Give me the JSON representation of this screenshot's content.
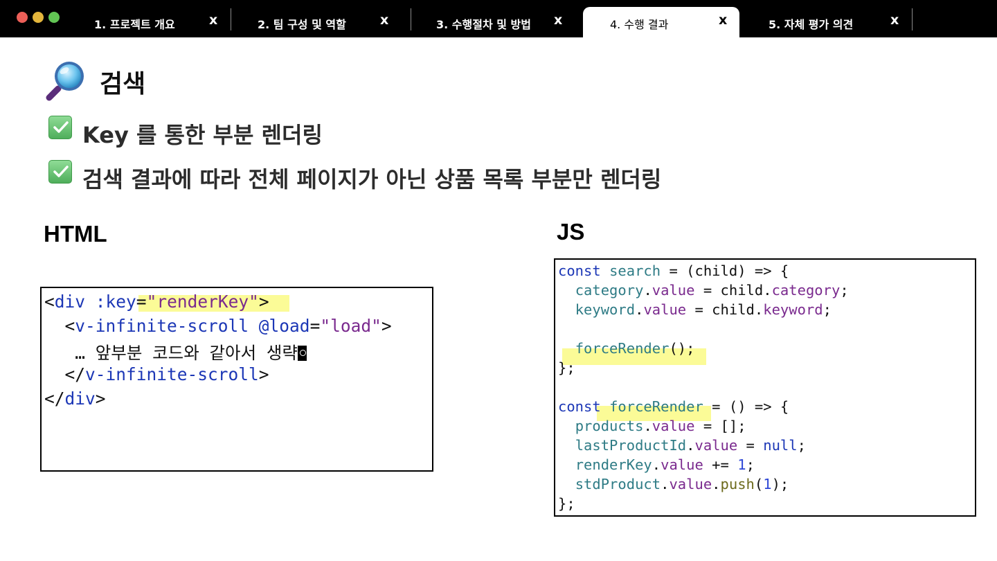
{
  "tabs": [
    {
      "label": "1. 프로젝트 개요",
      "close": "x",
      "active": false
    },
    {
      "label": "2. 팀 구성 및 역할",
      "close": "x",
      "active": false
    },
    {
      "label": "3. 수행절차 및 방법",
      "close": "x",
      "active": false
    },
    {
      "label": "4. 수행 결과",
      "close": "x",
      "active": true
    },
    {
      "label": "5. 자체 평가 의견",
      "close": "x",
      "active": false
    }
  ],
  "heading": {
    "title": "검색"
  },
  "bullets": [
    "Key 를 통한 부분 렌더링",
    "검색 결과에 따라 전체 페이지가 아닌 상품 목록 부분만 렌더링"
  ],
  "sections": {
    "html_label": "HTML",
    "js_label": "JS"
  },
  "html_code": {
    "l1": {
      "open": "<",
      "tag": "div",
      "attr": " :key",
      "eq": "=",
      "q1": "\"",
      "val": "renderKey",
      "q2": "\"",
      "close": ">"
    },
    "l2": {
      "indent": "  ",
      "open": "<",
      "tag": "v-infinite-scroll",
      "attr": " @load",
      "eq": "=",
      "q1": "\"",
      "val": "load",
      "q2": "\"",
      "close": ">"
    },
    "l3": {
      "text": "   … 앞부분 코드와 같아서 생략"
    },
    "l4": {
      "indent": "  ",
      "open": "</",
      "tag": "v-infinite-scroll",
      "close": ">"
    },
    "l5": {
      "open": "</",
      "tag": "div",
      "close": ">"
    }
  },
  "js_code": {
    "l1": {
      "kw": "const",
      "sp": " ",
      "name": "search",
      "rest": " = (child) => {"
    },
    "l2": {
      "indent": "  ",
      "obj": "category",
      "dot": ".",
      "prop": "value",
      "mid": " = child.",
      "prop2": "category",
      "end": ";"
    },
    "l3": {
      "indent": "  ",
      "obj": "keyword",
      "dot": ".",
      "prop": "value",
      "mid": " = child.",
      "prop2": "keyword",
      "end": ";"
    },
    "l5": {
      "indent": "  ",
      "fn": "forceRender",
      "end": "();"
    },
    "l6": {
      "text": "};"
    },
    "l8": {
      "kw": "const",
      "sp": " ",
      "name": "forceRender",
      "rest": " = () => {"
    },
    "l9": {
      "indent": "  ",
      "obj": "products",
      "dot": ".",
      "prop": "value",
      "end": " = [];"
    },
    "l10": {
      "indent": "  ",
      "obj": "lastProductId",
      "dot": ".",
      "prop": "value",
      "mid": " = ",
      "lit": "null",
      "end": ";"
    },
    "l11": {
      "indent": "  ",
      "obj": "renderKey",
      "dot": ".",
      "prop": "value",
      "mid": " += ",
      "num": "1",
      "end": ";"
    },
    "l12": {
      "indent": "  ",
      "obj": "stdProduct",
      "dot": ".",
      "prop": "value",
      "dot2": ".",
      "method": "push",
      "p1": "(",
      "num": "1",
      "p2": ");"
    },
    "l13": {
      "text": "};"
    }
  },
  "colors": {
    "keyword_blue": "#1c37b6",
    "value_purple": "#7a2a8e",
    "identifier_teal": "#2e7b85",
    "highlight_yellow": "#fbfb8c",
    "window_red": "#ec5f58",
    "window_yellow": "#e4b63c",
    "window_green": "#62c554"
  }
}
